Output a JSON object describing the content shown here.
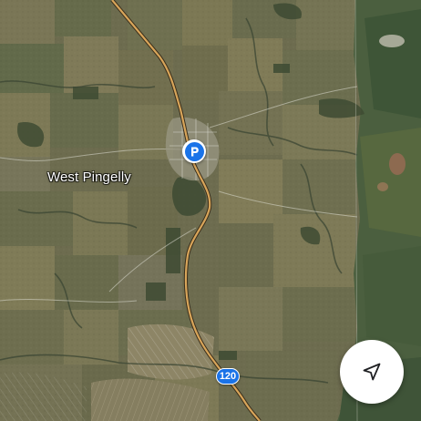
{
  "map": {
    "view_type": "satellite",
    "place_label": "West Pingelly",
    "town_marker_icon": "parking-icon",
    "route_shield_number": "120",
    "recenter_button_icon": "navigation-arrow-icon",
    "colors": {
      "road": "#d8a55a",
      "road_edge": "#3a2f1c",
      "marker_blue": "#1a73e8",
      "terrain_base": "#6b6b4e",
      "forest_green": "#3f5a3a"
    }
  }
}
